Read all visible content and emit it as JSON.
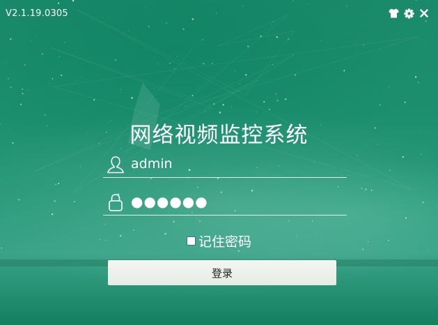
{
  "version": "V2.1.19.0305",
  "window_controls": [
    {
      "icon": "shirt-icon",
      "name": "skin"
    },
    {
      "icon": "gear-icon",
      "name": "settings"
    },
    {
      "icon": "close-icon",
      "name": "close"
    }
  ],
  "title": "网络视频监控系统",
  "username": {
    "icon": "user-icon",
    "value": "admin"
  },
  "password": {
    "icon": "lock-icon",
    "value": "●●●●●●"
  },
  "remember": {
    "label": "记住密码",
    "checked": false
  },
  "login_button": "登录",
  "colors": {
    "background": "#1c8f6e",
    "text": "#ffffff",
    "button_bg": "#eef1ec"
  }
}
